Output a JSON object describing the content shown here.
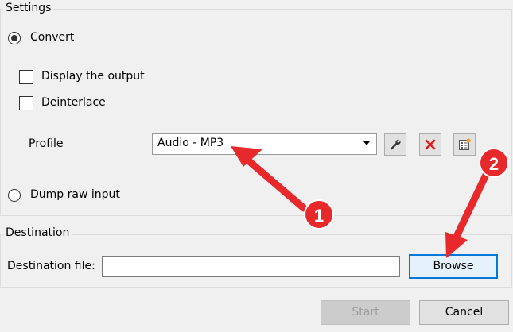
{
  "settings": {
    "title": "Settings",
    "convert_label": "Convert",
    "display_output_label": "Display the output",
    "deinterlace_label": "Deinterlace",
    "profile_label": "Profile",
    "profile_value": "Audio - MP3",
    "dump_raw_label": "Dump raw input"
  },
  "destination": {
    "title": "Destination",
    "file_label": "Destination file:",
    "file_value": "",
    "browse_label": "Browse"
  },
  "footer": {
    "start_label": "Start",
    "cancel_label": "Cancel"
  },
  "annotations": {
    "marker_1": "1",
    "marker_2": "2",
    "color": "#e8292c"
  },
  "icons": {
    "edit_profile": "wrench-icon",
    "delete_profile": "red-x-icon",
    "new_profile": "new-profile-icon"
  }
}
